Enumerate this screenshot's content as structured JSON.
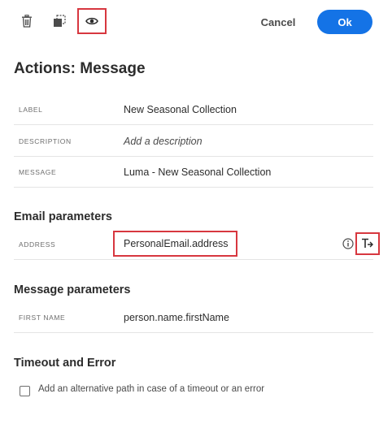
{
  "toolbar": {
    "icons": [
      "trash-icon",
      "duplicate-icon",
      "eye-icon"
    ],
    "cancel_label": "Cancel",
    "ok_label": "Ok"
  },
  "page_title": "Actions: Message",
  "properties": [
    {
      "label": "LABEL",
      "value": "New Seasonal Collection"
    },
    {
      "label": "DESCRIPTION",
      "placeholder": "Add a description"
    },
    {
      "label": "MESSAGE",
      "value": "Luma - New Seasonal Collection"
    }
  ],
  "email_parameters": {
    "title": "Email parameters",
    "address_label": "ADDRESS",
    "address_value": "PersonalEmail.address",
    "icons": [
      "info-icon",
      "text-expression-icon"
    ]
  },
  "message_parameters": {
    "title": "Message parameters",
    "first_name_label": "FIRST NAME",
    "first_name_value": "person.name.firstName"
  },
  "timeout": {
    "title": "Timeout and Error",
    "checkbox_label": "Add an alternative path in case of a timeout or an error",
    "checked": false
  },
  "colors": {
    "primary": "#1473e6",
    "highlight": "#d7373f"
  }
}
